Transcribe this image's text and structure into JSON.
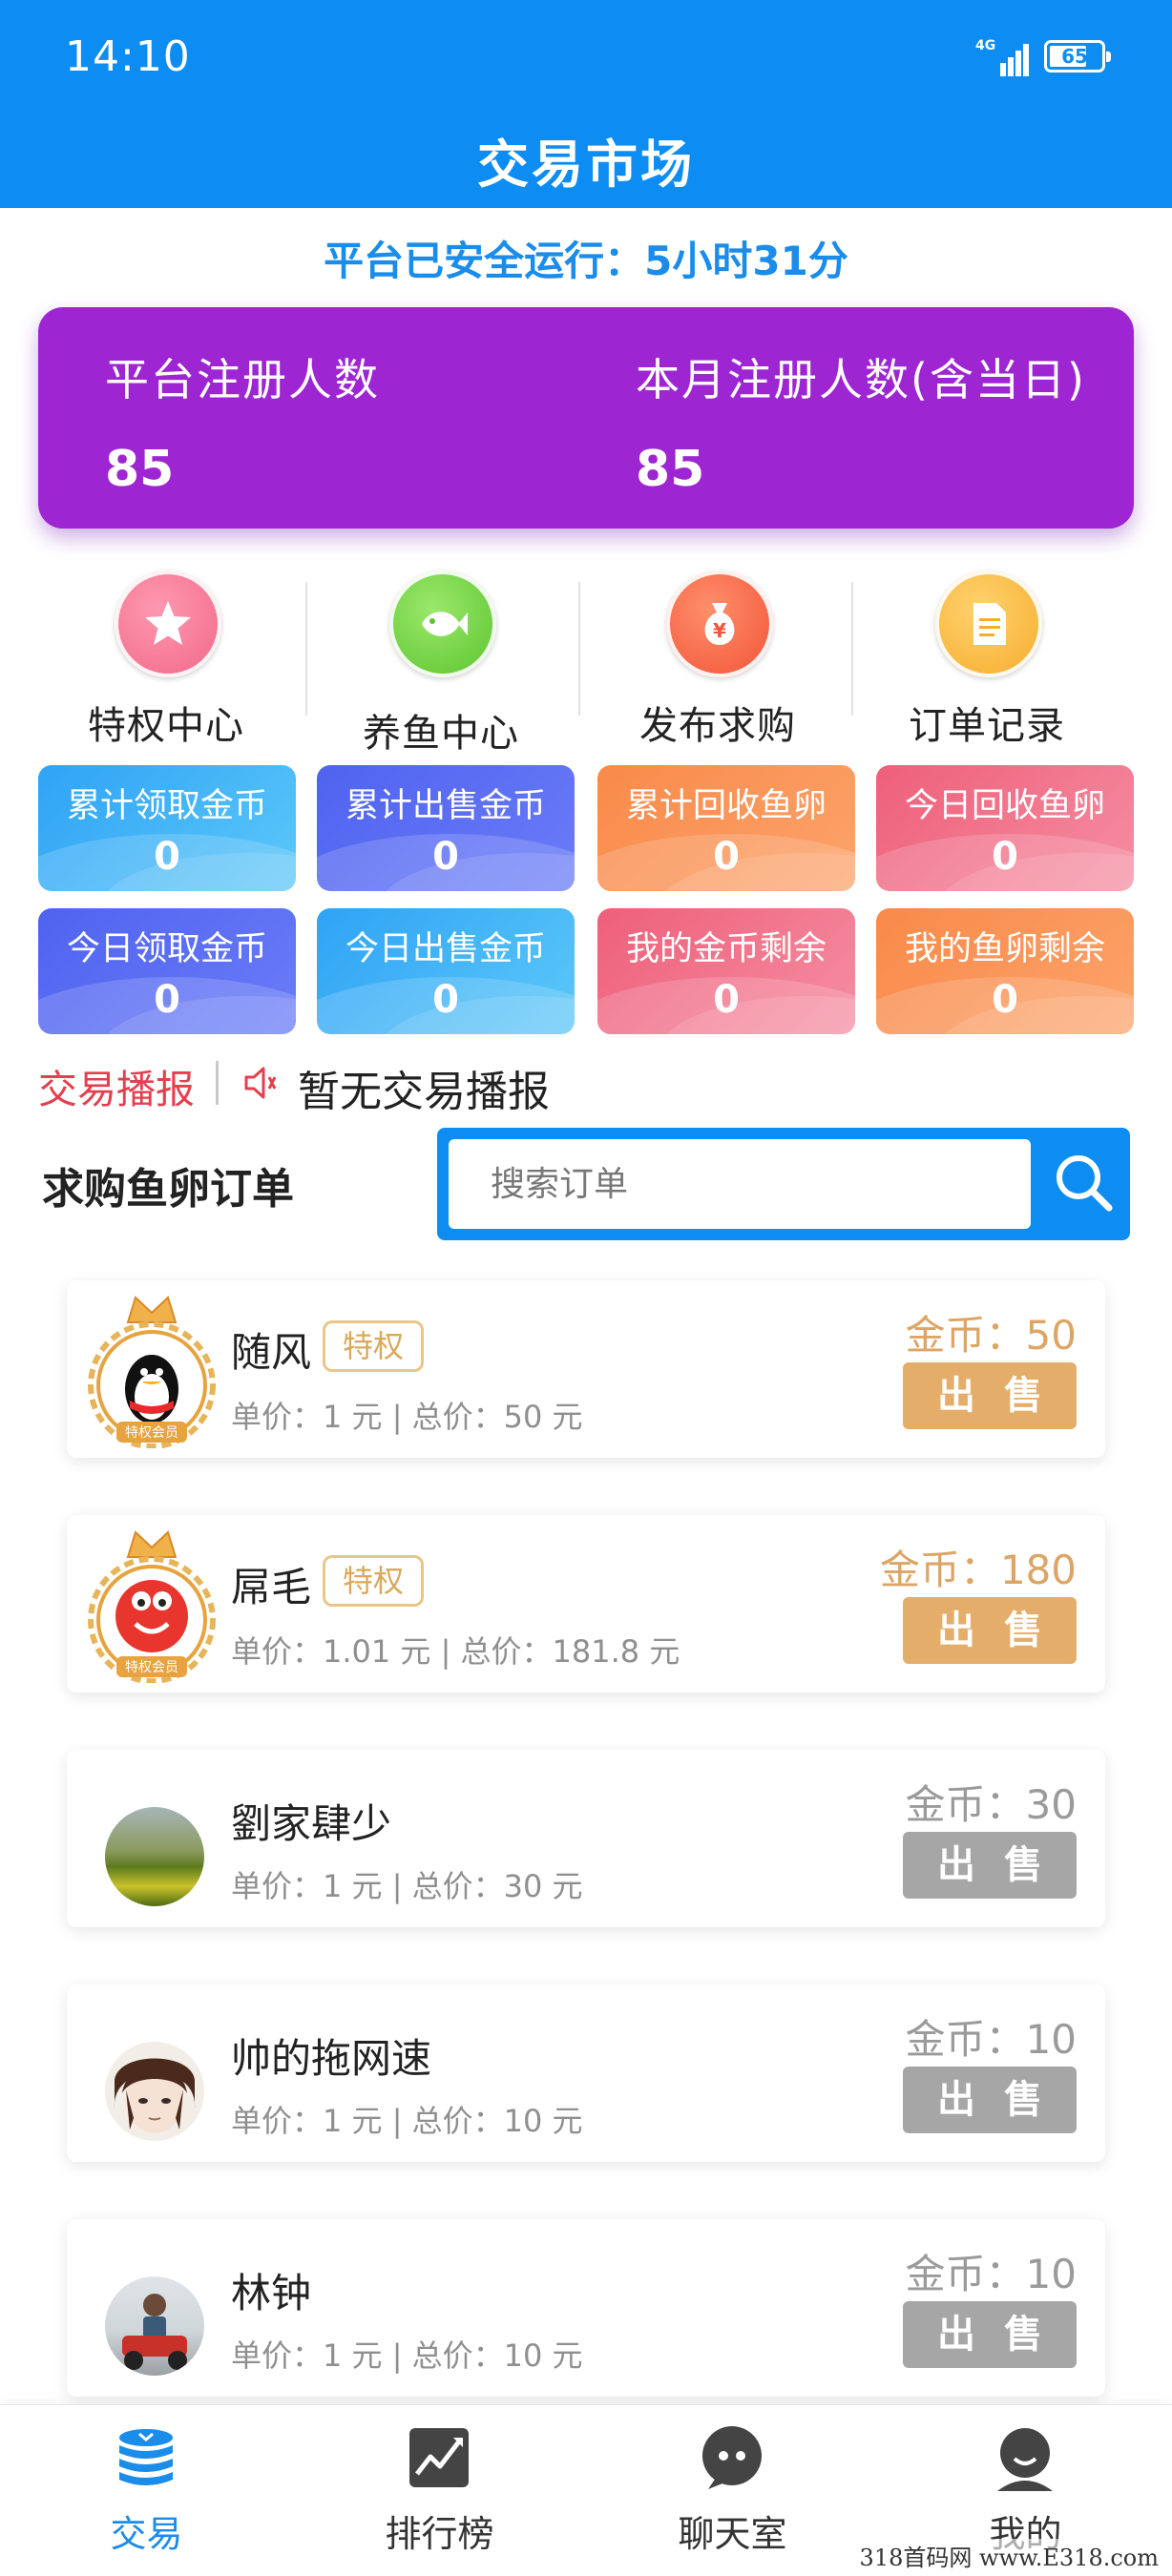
{
  "status_bar": {
    "time": "14:10",
    "network": "4G",
    "battery": "65"
  },
  "header": {
    "title": "交易市场"
  },
  "uptime": "平台已安全运行：5小时31分",
  "registration": {
    "total_label": "平台注册人数",
    "total_value": "85",
    "month_label": "本月注册人数(含当日)",
    "month_value": "85"
  },
  "menu": [
    {
      "label": "特权中心",
      "icon": "star-icon",
      "color": "#f06a8a"
    },
    {
      "label": "养鱼中心",
      "icon": "fish-icon",
      "color": "#68cf3d"
    },
    {
      "label": "发布求购",
      "icon": "money-bag-icon",
      "color": "#f4623f"
    },
    {
      "label": "订单记录",
      "icon": "document-icon",
      "color": "#f8b83a"
    }
  ],
  "stats": [
    {
      "label": "累计领取金币",
      "value": "0"
    },
    {
      "label": "累计出售金币",
      "value": "0"
    },
    {
      "label": "累计回收鱼卵",
      "value": "0"
    },
    {
      "label": "今日回收鱼卵",
      "value": "0"
    },
    {
      "label": "今日领取金币",
      "value": "0"
    },
    {
      "label": "今日出售金币",
      "value": "0"
    },
    {
      "label": "我的金币剩余",
      "value": "0"
    },
    {
      "label": "我的鱼卵剩余",
      "value": "0"
    }
  ],
  "broadcast": {
    "title": "交易播报",
    "text": "暂无交易播报"
  },
  "orders_section": {
    "title": "求购鱼卵订单",
    "search_placeholder": "搜索订单"
  },
  "orders": [
    {
      "name": "随风",
      "badge": "特权",
      "price": "单价：1 元 | 总价：50 元",
      "coins": "金币：50",
      "button": "出售",
      "vip": true,
      "member_tag": "特权会员"
    },
    {
      "name": "屌毛",
      "badge": "特权",
      "price": "单价：1.01 元 | 总价：181.8 元",
      "coins": "金币：180",
      "button": "出售",
      "vip": true,
      "member_tag": "特权会员"
    },
    {
      "name": "劉家肆少",
      "badge": "",
      "price": "单价：1 元 | 总价：30 元",
      "coins": "金币：30",
      "button": "出售",
      "vip": false
    },
    {
      "name": "帅的拖网速",
      "badge": "",
      "price": "单价：1 元 | 总价：10 元",
      "coins": "金币：10",
      "button": "出售",
      "vip": false
    },
    {
      "name": "林钟",
      "badge": "",
      "price": "单价：1 元 | 总价：10 元",
      "coins": "金币：10",
      "button": "出售",
      "vip": false
    }
  ],
  "bottom_nav": [
    {
      "label": "交易",
      "icon": "coins-stack-icon",
      "active": true
    },
    {
      "label": "排行榜",
      "icon": "chart-icon",
      "active": false
    },
    {
      "label": "聊天室",
      "icon": "chat-icon",
      "active": false
    },
    {
      "label": "我的",
      "icon": "user-icon",
      "active": false
    }
  ],
  "watermark": "318首码网 www.E318.com"
}
